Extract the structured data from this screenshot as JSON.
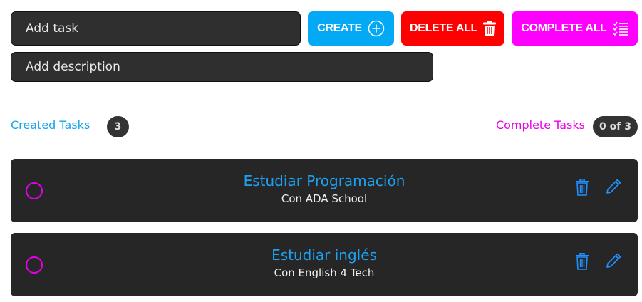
{
  "inputs": {
    "task_placeholder": "Add task",
    "description_placeholder": "Add description"
  },
  "buttons": {
    "create": "CREATE",
    "delete_all": "DELETE ALL",
    "complete_all": "COMPLETE ALL"
  },
  "counters": {
    "created_label": "Created Tasks",
    "created_count": "3",
    "complete_label": "Complete Tasks",
    "complete_count": "0 of 3"
  },
  "tasks": [
    {
      "title": "Estudiar Programación",
      "description": "Con ADA School",
      "completed": false
    },
    {
      "title": "Estudiar inglés",
      "description": "Con English 4 Tech",
      "completed": false
    }
  ],
  "colors": {
    "accent_blue": "#03a9f4",
    "danger_red": "#ff0000",
    "magenta": "#ff00ff",
    "card_bg": "#262626"
  }
}
